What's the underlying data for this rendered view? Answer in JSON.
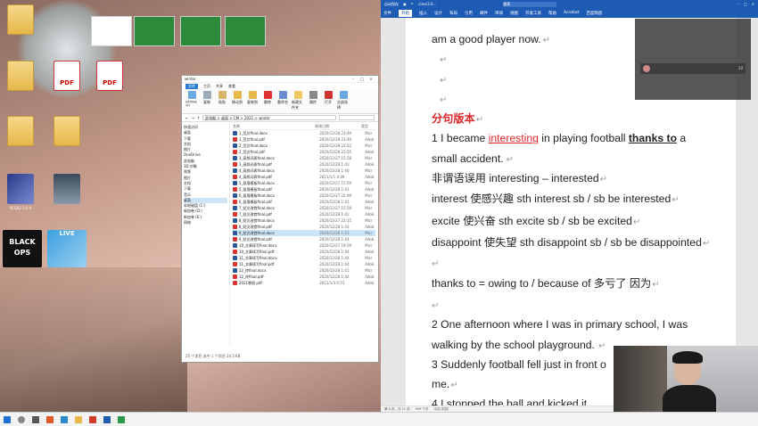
{
  "desktop": {
    "icons": [
      {
        "label": "",
        "type": "folder"
      },
      {
        "label": "",
        "type": "pdf",
        "glyph": "PDF"
      },
      {
        "label": "",
        "type": "pdf",
        "glyph": "PDF"
      },
      {
        "label": "",
        "type": "folder"
      },
      {
        "label": "",
        "type": "folder"
      },
      {
        "label": "",
        "type": "folder"
      },
      {
        "label": "PCSX2 1.6.0",
        "type": "app"
      },
      {
        "label": "",
        "type": "app"
      },
      {
        "label": "",
        "type": "game",
        "glyph": "BLACK OPS"
      },
      {
        "label": "",
        "type": "game",
        "glyph": "LIVE"
      }
    ]
  },
  "explorer": {
    "title": "winter",
    "tabs": [
      "文件",
      "主页",
      "共享",
      "查看"
    ],
    "ribbon": [
      "固定到快速访问",
      "复制",
      "粘贴",
      "剪切",
      "复制路径",
      "粘贴快捷方式",
      "移动到",
      "复制到",
      "删除",
      "重命名",
      "新建文件夹",
      "新建项目",
      "属性",
      "打开",
      "全部选择"
    ],
    "address": "此电脑 > 桌面 > CM > 2021 > winter",
    "nav": [
      "快速访问",
      "桌面",
      "下载",
      "文档",
      "图片",
      "OneDrive",
      "此电脑",
      "3D 对象",
      "视频",
      "图片",
      "文档",
      "下载",
      "音乐",
      "桌面",
      "本地磁盘 (C:)",
      "新加卷 (D:)",
      "新加卷 (E:)",
      "网络"
    ],
    "files": [
      {
        "name": "1_范文final.docx",
        "date": "2020/12/28 23:49",
        "type": "Micr"
      },
      {
        "name": "1_范文final.pdf",
        "date": "2020/12/28 23:49",
        "type": "Adob"
      },
      {
        "name": "2_范文final.docx",
        "date": "2020/12/28 23:52",
        "type": "Micr"
      },
      {
        "name": "2_范文final.pdf",
        "date": "2020/12/28 23:55",
        "type": "Adob"
      },
      {
        "name": "3_高频词表final.docx",
        "date": "2020/12/27 15:58",
        "type": "Micr"
      },
      {
        "name": "3_高频词表final.pdf",
        "date": "2020/12/28 1:42",
        "type": "Adob"
      },
      {
        "name": "4_高频词表final.docx",
        "date": "2020/12/28 1:40",
        "type": "Micr"
      },
      {
        "name": "4_高频词表final.pdf",
        "date": "2021/1/1 0:49",
        "type": "Adob"
      },
      {
        "name": "5_段落模板final.docx",
        "date": "2020/12/27 15:59",
        "type": "Micr"
      },
      {
        "name": "5_段落模板final.pdf",
        "date": "2020/12/28 1:42",
        "type": "Adob"
      },
      {
        "name": "6_段落模板final.docx",
        "date": "2020/12/27 22:09",
        "type": "Micr"
      },
      {
        "name": "6_段落模板final.pdf",
        "date": "2020/12/28 1:41",
        "type": "Adob"
      },
      {
        "name": "7_短文改错final.docx",
        "date": "2020/12/27 15:59",
        "type": "Micr"
      },
      {
        "name": "7_短文改错final.pdf",
        "date": "2020/12/28 1:42",
        "type": "Adob"
      },
      {
        "name": "8_短文改错final.docx",
        "date": "2020/12/27 22:15",
        "type": "Micr"
      },
      {
        "name": "8_短文改错final.pdf",
        "date": "2020/12/28 1:43",
        "type": "Adob"
      },
      {
        "name": "9_短文改错final.docx",
        "date": "2020/12/28 1:12",
        "type": "Micr"
      },
      {
        "name": "9_短文改错final.pdf",
        "date": "2020/12/28 1:44",
        "type": "Adob"
      },
      {
        "name": "10_文章续写final.docx",
        "date": "2020/12/27 19:59",
        "type": "Micr"
      },
      {
        "name": "10_文章续写final.pdf",
        "date": "2020/12/28 1:44",
        "type": "Adob"
      },
      {
        "name": "11_文章续写final.docx",
        "date": "2020/12/28 1:44",
        "type": "Micr"
      },
      {
        "name": "11_文章续写final.pdf",
        "date": "2020/12/28 1:44",
        "type": "Adob"
      },
      {
        "name": "12_终final.docx",
        "date": "2020/12/28 1:41",
        "type": "Micr"
      },
      {
        "name": "12_终final.pdf",
        "date": "2020/12/28 1:44",
        "type": "Adob"
      },
      {
        "name": "2021寒假.pdf",
        "date": "2021/1/3 0:51",
        "type": "Adob"
      }
    ],
    "selected_index": 16,
    "status": "25 个项目    选中 1 个项目 24.5 KB"
  },
  "word": {
    "title_left": "自动保存",
    "doc_title": "class3.d...",
    "search_label": "搜索",
    "menu": [
      "文件",
      "开始",
      "插入",
      "设计",
      "布局",
      "引用",
      "邮件",
      "审阅",
      "视图",
      "开发工具",
      "帮助",
      "Acrobat",
      "百度网盘"
    ],
    "active_menu_index": 1,
    "lines": {
      "l1": "am a good player now.",
      "para_mark": "↵",
      "heading": "分句版本",
      "l_s1a": "1   I became ",
      "l_s1b": "interesting",
      "l_s1c": " in playing football ",
      "l_s1d": "thanks to",
      "l_s1e": " a",
      "l_s1f": "small accident.",
      "l_note": "非谓语误用  interesting – interested",
      "l_int": "interest   使感兴趣    sth interest sb / sb be interested",
      "l_exc": "excite  使兴奋    sth excite sb / sb be excited",
      "l_dis": "disappoint  使失望 sth disappoint sb / sb be disappointed",
      "l_thanks": "thanks to = owing to / because of  多亏了  因为",
      "l_s2a": "2   One afternoon where I was in primary school, I was",
      "l_s2b": "walking by the school playground.",
      "l_s3": "3   Suddenly football fell just in front o",
      "l_me": "me.",
      "l_s4": "4   I stopped the ball and kicked it"
    },
    "status": [
      "第 6 页，共 11 页",
      "999 个字",
      "中文(中国)"
    ]
  },
  "meeting": {
    "rows": [
      "",
      "",
      "",
      ""
    ],
    "user_name": "",
    "user_count": "10"
  },
  "taskbar": {
    "time": ""
  }
}
